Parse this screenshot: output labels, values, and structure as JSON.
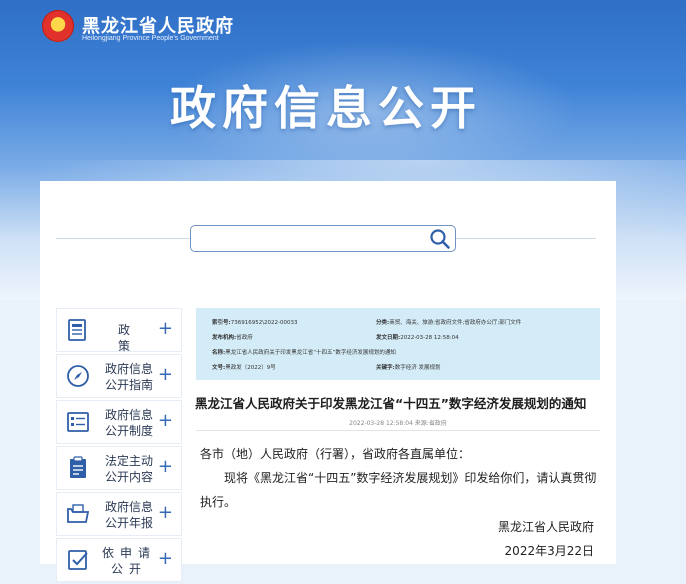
{
  "header": {
    "site_name": "黑龙江省人民政府",
    "site_name_en": "Heilongjiang Province People's Government",
    "banner_title": "政府信息公开"
  },
  "search": {
    "placeholder": ""
  },
  "sidebar": {
    "items": [
      {
        "label": "政 策",
        "icon": "policy-doc-icon"
      },
      {
        "label": "政府信息公开指南",
        "icon": "compass-icon"
      },
      {
        "label": "政府信息公开制度",
        "icon": "list-doc-icon"
      },
      {
        "label": "法定主动公开内容",
        "icon": "clipboard-icon"
      },
      {
        "label": "政府信息公开年报",
        "icon": "folder-icon"
      },
      {
        "label": "依申请公开",
        "icon": "apply-icon"
      }
    ],
    "plus": "+"
  },
  "meta": {
    "index_label": "索引号:",
    "index_value": "736916952\\2022-00033",
    "category_label": "分类:",
    "category_value": "商贸、海关、旅游;省政府文件;省政府办公厅;部门文件",
    "publisher_label": "发布机构:",
    "publisher_value": "省政府",
    "date_label": "发文日期:",
    "date_value": "2022-03-28 12:58:04",
    "name_label": "名称:",
    "name_value": "黑龙江省人民政府关于印发黑龙江省“十四五”数字经济发展规划的通知",
    "docno_label": "文号:",
    "docno_value": "黑政发〔2022〕9号",
    "keywords_label": "关键字:",
    "keywords_value": "数字经济 发展规划"
  },
  "document": {
    "title": "黑龙江省人民政府关于印发黑龙江省“十四五”数字经济发展规划的通知",
    "date_source": "2022-03-28 12:58:04 来源:省政府",
    "salutation": "各市（地）人民政府（行署），省政府各直属单位：",
    "body": "现将《黑龙江省“十四五”数字经济发展规划》印发给你们，请认真贯彻执行。",
    "signature": "黑龙江省人民政府",
    "sign_date": "2022年3月22日"
  }
}
